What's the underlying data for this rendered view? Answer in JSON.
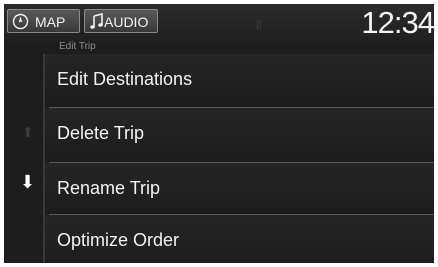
{
  "header": {
    "map_label": "MAP",
    "audio_label": "AUDIO",
    "clock": "12:34",
    "map_icon": "compass-icon",
    "audio_icon": "music-note-icon"
  },
  "screen_title": "Edit Trip",
  "menu": {
    "items": [
      {
        "label": "Edit Destinations"
      },
      {
        "label": "Delete Trip"
      },
      {
        "label": "Rename Trip"
      },
      {
        "label": "Optimize Order"
      }
    ]
  },
  "scroll": {
    "up_icon": "arrow-up-icon",
    "down_icon": "arrow-down-icon"
  }
}
